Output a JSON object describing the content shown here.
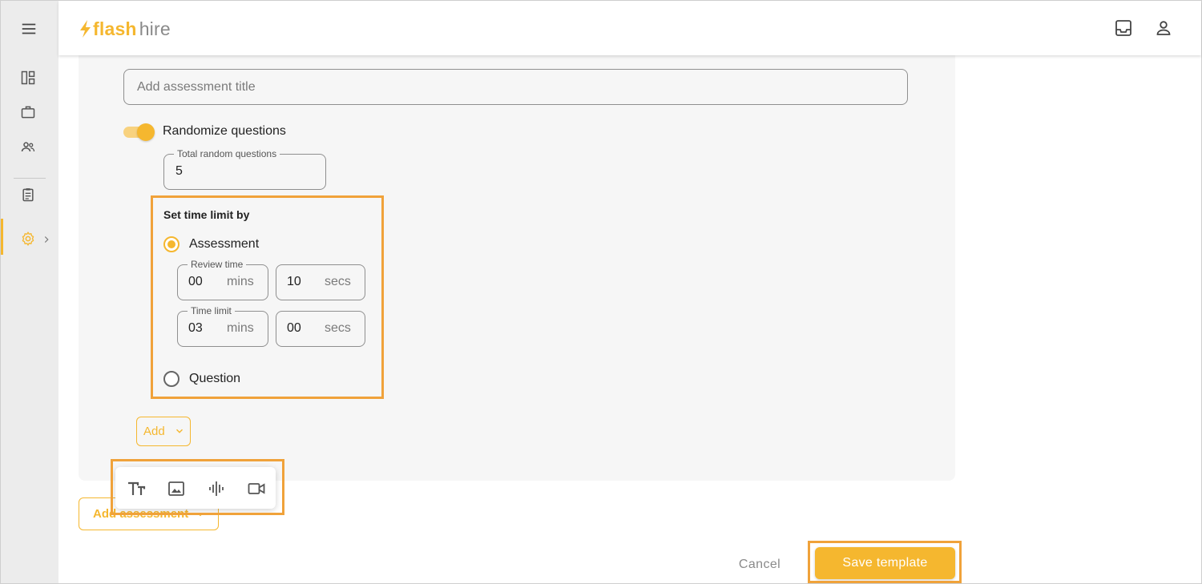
{
  "app": {
    "logo_brand": "flash",
    "logo_suffix": "hire"
  },
  "sidebar": {
    "items": [
      {
        "icon": "menu-icon"
      },
      {
        "icon": "dashboard-icon"
      },
      {
        "icon": "briefcase-icon"
      },
      {
        "icon": "people-icon"
      },
      {
        "icon": "clipboard-icon"
      },
      {
        "icon": "gear-icon",
        "active": true
      }
    ]
  },
  "header": {
    "icons": [
      "inbox-icon",
      "user-icon"
    ]
  },
  "form": {
    "title_placeholder": "Add assessment title",
    "title_value": "",
    "randomize_label": "Randomize questions",
    "randomize_on": true,
    "total_random": {
      "label": "Total random questions",
      "value": "5"
    },
    "time_limit": {
      "section_title": "Set time limit by",
      "options": [
        {
          "label": "Assessment",
          "selected": true
        },
        {
          "label": "Question",
          "selected": false
        }
      ],
      "review_time": {
        "label": "Review time",
        "mins": "00",
        "secs": "10"
      },
      "limit": {
        "label": "Time limit",
        "mins": "03",
        "secs": "00"
      },
      "unit_mins": "mins",
      "unit_secs": "secs"
    },
    "add_label": "Add",
    "media_options": [
      "text-icon",
      "image-icon",
      "audio-icon",
      "video-icon"
    ],
    "add_assessment_label": "Add assessment"
  },
  "actions": {
    "cancel_label": "Cancel",
    "save_label": "Save template"
  },
  "colors": {
    "accent": "#f5b72f",
    "highlight": "#f0a23a"
  }
}
